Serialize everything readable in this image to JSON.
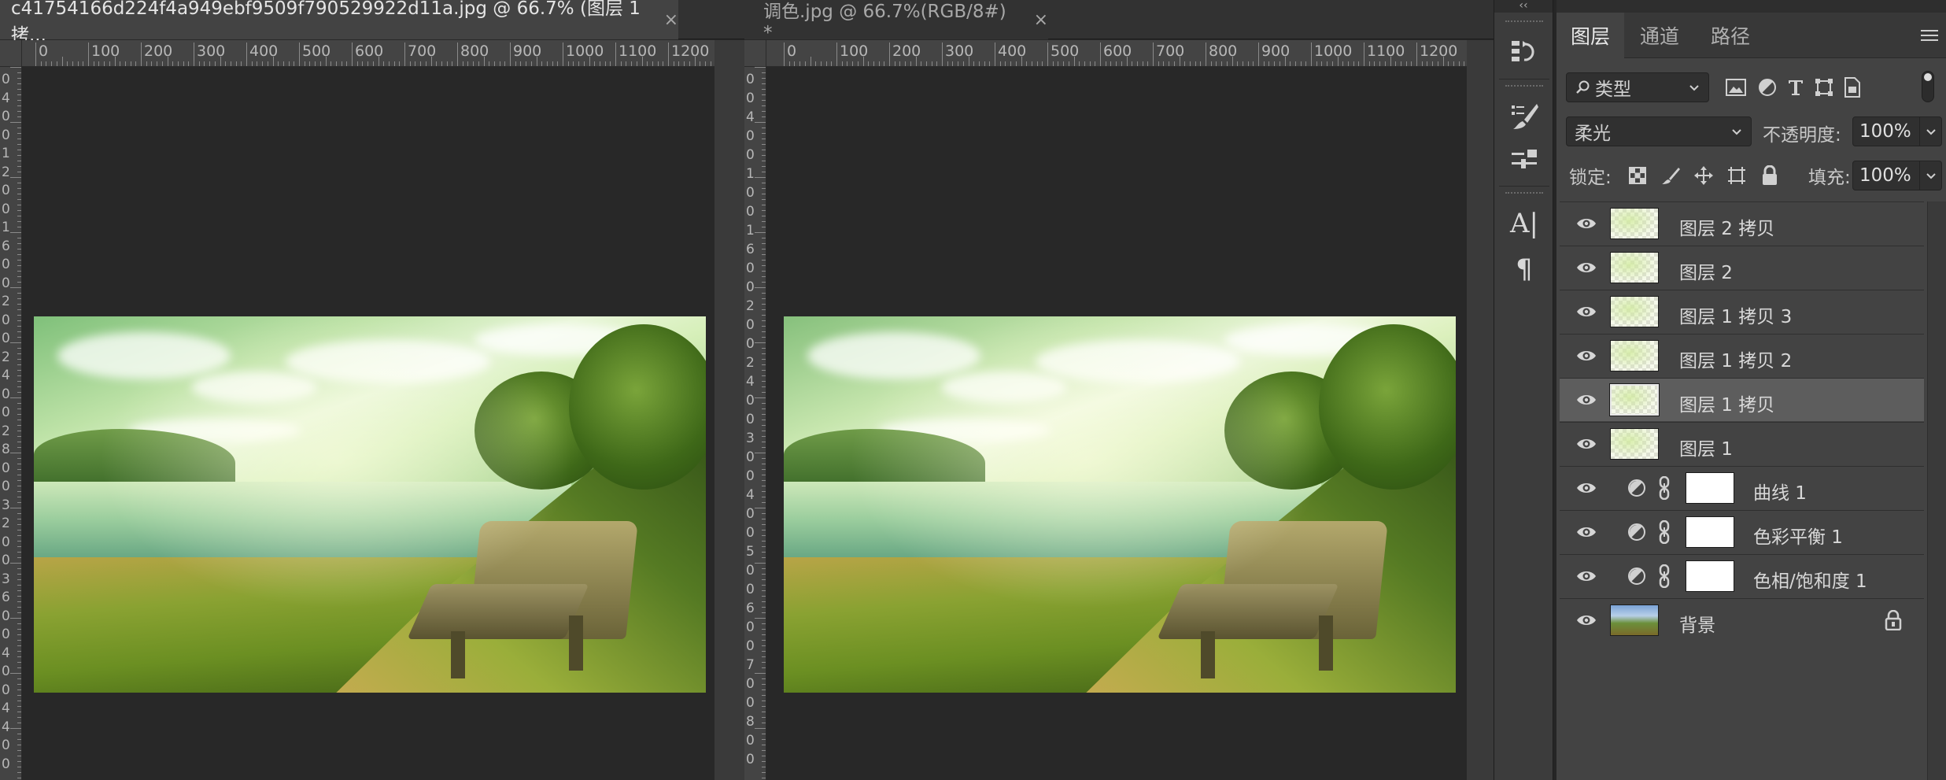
{
  "documents": [
    {
      "tab_title": "c41754166d224f4a949ebf9509f790529922d11a.jpg  @  66.7%  (图层 1 拷...",
      "ruler_labels": [
        "0",
        "100",
        "200",
        "300",
        "400",
        "500",
        "600",
        "700",
        "800",
        "900",
        "1000",
        "1100",
        "1200"
      ]
    },
    {
      "tab_title": "调色.jpg @ 66.7%(RGB/8#) *",
      "ruler_labels": [
        "0",
        "100",
        "200",
        "300",
        "400",
        "500",
        "600",
        "700",
        "800",
        "900",
        "1000",
        "1100",
        "1200"
      ]
    }
  ],
  "close_glyph": "×",
  "vruler_left_labels": [
    "0",
    "4",
    "0",
    "0",
    "1",
    "2",
    "0",
    "0",
    "1",
    "6",
    "0",
    "0",
    "2",
    "0",
    "0",
    "2",
    "4",
    "0",
    "0",
    "2",
    "8",
    "0",
    "0",
    "3",
    "2",
    "0",
    "0",
    "3",
    "6",
    "0",
    "0",
    "4",
    "0",
    "0",
    "4",
    "4",
    "0",
    "0"
  ],
  "vruler_right_labels": [
    "0",
    "0",
    "4",
    "0",
    "0",
    "1",
    "0",
    "0",
    "1",
    "6",
    "0",
    "0",
    "2",
    "0",
    "0",
    "2",
    "4",
    "0",
    "0",
    "3",
    "0",
    "0",
    "4",
    "0",
    "0",
    "5",
    "0",
    "0",
    "6",
    "0",
    "0",
    "7",
    "0",
    "0",
    "8",
    "0",
    "0"
  ],
  "toolstrip": {
    "collapse_glyph": "‹‹",
    "char_tool_glyph": "A|",
    "para_tool_glyph": "¶"
  },
  "panel": {
    "tabs": [
      {
        "label": "图层",
        "active": true
      },
      {
        "label": "通道",
        "active": false
      },
      {
        "label": "路径",
        "active": false
      }
    ],
    "filter_label": "类型",
    "blend_mode": "柔光",
    "opacity_label": "不透明度:",
    "opacity_value": "100%",
    "lock_label": "锁定:",
    "fill_label": "填充:",
    "fill_value": "100%"
  },
  "layers": [
    {
      "name": "图层 2 拷贝",
      "kind": "pixel",
      "selected": false
    },
    {
      "name": "图层 2",
      "kind": "pixel",
      "selected": false
    },
    {
      "name": "图层 1 拷贝 3",
      "kind": "pixel",
      "selected": false
    },
    {
      "name": "图层 1 拷贝 2",
      "kind": "pixel",
      "selected": false
    },
    {
      "name": "图层 1 拷贝",
      "kind": "pixel",
      "selected": true
    },
    {
      "name": "图层 1",
      "kind": "pixel",
      "selected": false
    },
    {
      "name": "曲线 1",
      "kind": "adjustment",
      "selected": false
    },
    {
      "name": "色彩平衡 1",
      "kind": "adjustment",
      "selected": false
    },
    {
      "name": "色相/饱和度 1",
      "kind": "adjustment",
      "selected": false
    },
    {
      "name": "背景",
      "kind": "background",
      "selected": false
    }
  ],
  "colors": {
    "panel_bg": "#434343",
    "selected_row": "#5d5d5d",
    "canvas_bg": "#282828"
  }
}
